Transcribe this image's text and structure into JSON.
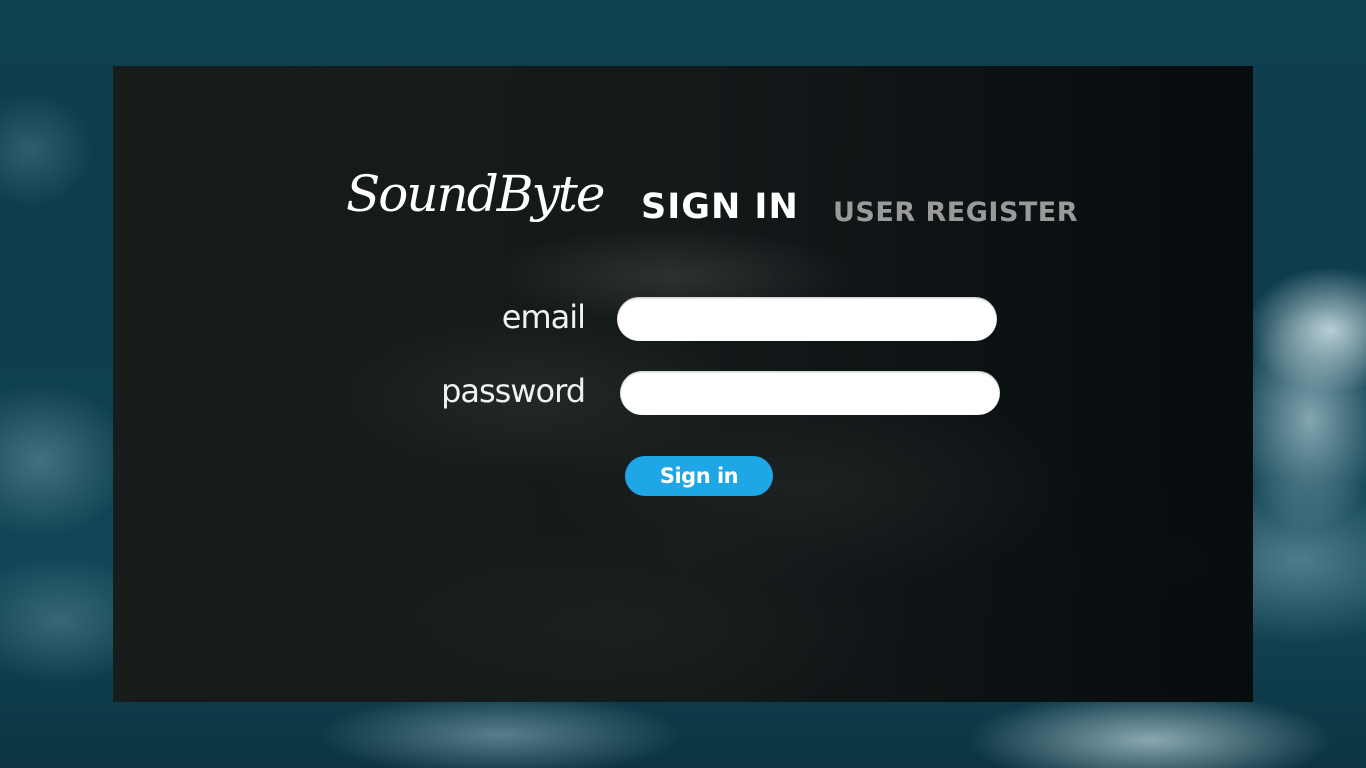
{
  "brand": {
    "logo_text": "SoundByte"
  },
  "tabs": [
    {
      "label": "SIGN IN",
      "active": true
    },
    {
      "label": "USER REGISTER",
      "active": false
    }
  ],
  "form": {
    "email_label": "email",
    "email_value": "",
    "password_label": "password",
    "password_value": "",
    "submit_label": "Sign in"
  },
  "colors": {
    "button": "#1fa6e6",
    "active_tab": "#ffffff",
    "inactive_tab": "#9a9a9a",
    "background": "#0e3d4d"
  }
}
